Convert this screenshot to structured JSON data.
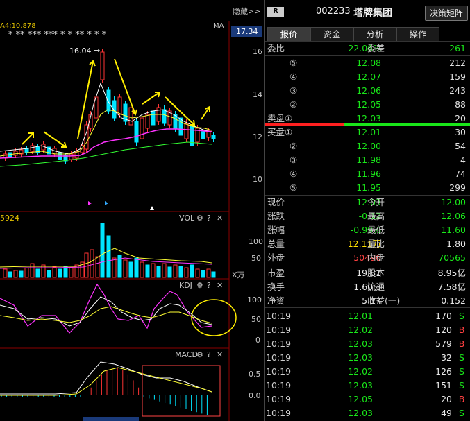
{
  "chart": {
    "ma_label": "A4:10.878",
    "ma_tag": "MA",
    "hide_label": "隐藏>>",
    "price_current": "17.34",
    "price_ticks": [
      "16",
      "14",
      "12",
      "10"
    ],
    "high_marker": "16.04",
    "stars_left": "* * *  ** ",
    "vol_title": "VOL",
    "vol_value": "5924",
    "vol_ticks": [
      "100",
      "50"
    ],
    "vol_unit": "X万",
    "kdj_title": "KDJ",
    "kdj_ticks": [
      "100",
      "50",
      "0"
    ],
    "macd_title": "MACD",
    "macd_ticks": [
      "0.5",
      "0.0"
    ],
    "panel_icons": [
      "gear-icon",
      "help-icon",
      "close-icon"
    ],
    "colors": {
      "up": "#ff3333",
      "down": "#00e5ff",
      "ma5": "#ffffff",
      "ma10": "#ffff33",
      "ma20": "#ff33ff",
      "ma30": "#33ff33",
      "grid": "#8b0000"
    }
  },
  "stock": {
    "badge": "R",
    "code": "002233",
    "name": "塔牌集团",
    "decision_button": "决策矩阵"
  },
  "tabs": [
    "报价",
    "资金",
    "分析",
    "操作"
  ],
  "order_book": {
    "ratio_label": "委比",
    "ratio_value": "-22.06%",
    "diff_label": "委差",
    "diff_value": "-261",
    "sell": [
      {
        "level": "⑤",
        "price": "12.08",
        "volume": "212"
      },
      {
        "level": "④",
        "price": "12.07",
        "volume": "159"
      },
      {
        "level": "③",
        "price": "12.06",
        "volume": "243"
      },
      {
        "level": "②",
        "price": "12.05",
        "volume": "88"
      },
      {
        "level": "卖盘①",
        "price": "12.03",
        "volume": "20"
      }
    ],
    "buy": [
      {
        "level": "买盘①",
        "price": "12.01",
        "volume": "30"
      },
      {
        "level": "②",
        "price": "12.00",
        "volume": "54"
      },
      {
        "level": "③",
        "price": "11.98",
        "volume": "4"
      },
      {
        "level": "④",
        "price": "11.96",
        "volume": "74"
      },
      {
        "level": "⑤",
        "price": "11.95",
        "volume": "299"
      }
    ]
  },
  "quote": [
    {
      "l1": "现价",
      "v1": "12.03",
      "c1": "green",
      "l2": "今开",
      "v2": "12.00",
      "c2": "green"
    },
    {
      "l1": "涨跌",
      "v1": "-0.12",
      "c1": "green",
      "l2": "最高",
      "v2": "12.06",
      "c2": "green"
    },
    {
      "l1": "涨幅",
      "v1": "-0.99%",
      "c1": "green",
      "l2": "最低",
      "v2": "11.60",
      "c2": "green"
    },
    {
      "l1": "总量",
      "v1": "12.11万",
      "c1": "yellow",
      "l2": "量比",
      "v2": "1.80",
      "c2": "white"
    },
    {
      "l1": "外盘",
      "v1": "50496",
      "c1": "red",
      "l2": "内盘",
      "v2": "70565",
      "c2": "green"
    },
    {
      "l1": "市盈",
      "v1": "19.81",
      "c1": "white",
      "l2": "股本",
      "v2": "8.95亿",
      "c2": "white"
    },
    {
      "l1": "换手",
      "v1": "1.60%",
      "c1": "white",
      "l2": "流通",
      "v2": "7.58亿",
      "c2": "white"
    },
    {
      "l1": "净资",
      "v1": "5.17",
      "c1": "white",
      "l2": "收益(一)",
      "v2": "0.152",
      "c2": "white"
    }
  ],
  "ticks": [
    {
      "time": "10:19",
      "price": "12.01",
      "volume": "170",
      "side": "S"
    },
    {
      "time": "10:19",
      "price": "12.02",
      "volume": "120",
      "side": "B"
    },
    {
      "time": "10:19",
      "price": "12.03",
      "volume": "579",
      "side": "B"
    },
    {
      "time": "10:19",
      "price": "12.03",
      "volume": "32",
      "side": "S"
    },
    {
      "time": "10:19",
      "price": "12.02",
      "volume": "126",
      "side": "S"
    },
    {
      "time": "10:19",
      "price": "12.03",
      "volume": "151",
      "side": "S"
    },
    {
      "time": "10:19",
      "price": "12.05",
      "volume": "20",
      "side": "B"
    },
    {
      "time": "10:19",
      "price": "12.03",
      "volume": "49",
      "side": "S"
    }
  ]
}
